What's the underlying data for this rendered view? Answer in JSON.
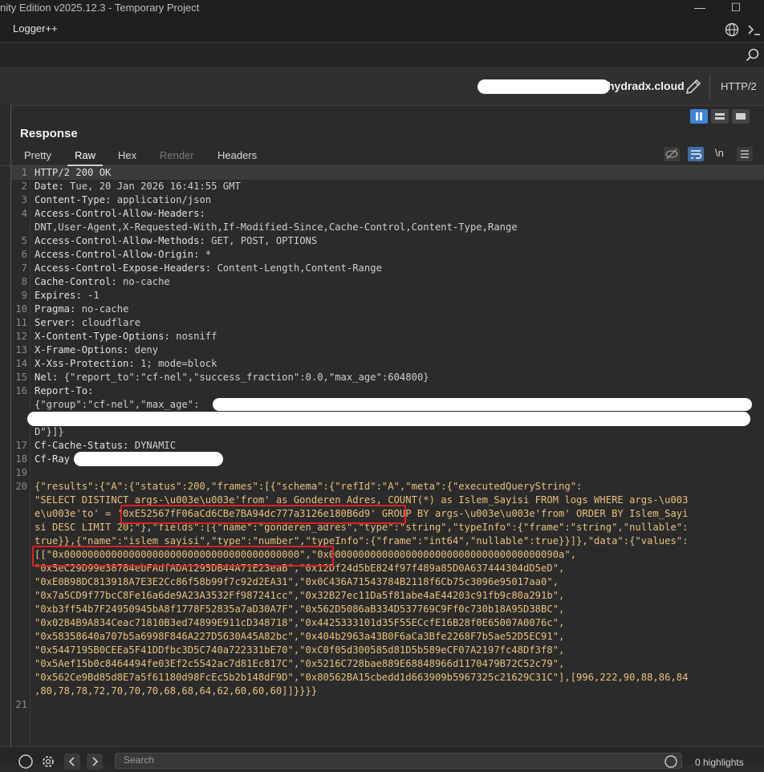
{
  "window": {
    "title": "nity Edition v2025.12.3 - Temporary Project",
    "minimize": "—",
    "maximize": "☐"
  },
  "menu": {
    "tab": "Logger++"
  },
  "target": {
    "host": "hydradx.cloud",
    "protocol": "HTTP/2"
  },
  "response": {
    "title": "Response",
    "tabs": [
      "Pretty",
      "Raw",
      "Hex",
      "Render",
      "Headers"
    ],
    "active_tab": "Raw",
    "newline_toggle": "\\n",
    "lines": [
      {
        "n": "1",
        "k": "HTTP/2 200 OK",
        "v": ""
      },
      {
        "n": "2",
        "k": "Date:",
        "v": " Tue, 20 Jan 2026 16:41:55 GMT"
      },
      {
        "n": "3",
        "k": "Content-Type:",
        "v": " application/json"
      },
      {
        "n": "4",
        "k": "Access-Control-Allow-Headers:",
        "v": ""
      },
      {
        "n": "",
        "k": "",
        "v": "DNT,User-Agent,X-Requested-With,If-Modified-Since,Cache-Control,Content-Type,Range"
      },
      {
        "n": "5",
        "k": "Access-Control-Allow-Methods:",
        "v": " GET, POST, OPTIONS"
      },
      {
        "n": "6",
        "k": "Access-Control-Allow-Origin:",
        "v": " *"
      },
      {
        "n": "7",
        "k": "Access-Control-Expose-Headers:",
        "v": " Content-Length,Content-Range"
      },
      {
        "n": "8",
        "k": "Cache-Control:",
        "v": " no-cache"
      },
      {
        "n": "9",
        "k": "Expires:",
        "v": " -1"
      },
      {
        "n": "10",
        "k": "Pragma:",
        "v": " no-cache"
      },
      {
        "n": "11",
        "k": "Server:",
        "v": " cloudflare"
      },
      {
        "n": "12",
        "k": "X-Content-Type-Options:",
        "v": " nosniff"
      },
      {
        "n": "13",
        "k": "X-Frame-Options:",
        "v": " deny"
      },
      {
        "n": "14",
        "k": "X-Xss-Protection:",
        "v": " 1; mode=block"
      },
      {
        "n": "15",
        "k": "Nel:",
        "v": " {\"report_to\":\"cf-nel\",\"success_fraction\":0.0,\"max_age\":604800}"
      },
      {
        "n": "16",
        "k": "Report-To:",
        "v": ""
      },
      {
        "n": "",
        "k": "",
        "v": "{\"group\":\"cf-nel\",\"max_age\":"
      },
      {
        "n": "",
        "k": "",
        "v": ""
      },
      {
        "n": "",
        "k": "",
        "v": "D\"}]}"
      },
      {
        "n": "17",
        "k": "Cf-Cache-Status:",
        "v": " DYNAMIC"
      },
      {
        "n": "18",
        "k": "Cf-Ray",
        "v": ""
      },
      {
        "n": "19",
        "k": "",
        "v": ""
      },
      {
        "n": "20",
        "k": "",
        "v": "{\"results\":{\"A\":{\"status\":200,\"frames\":[{\"schema\":{\"refId\":\"A\",\"meta\":{\"executedQueryString\":"
      },
      {
        "n": "",
        "k": "",
        "v": "\"SELECT DISTINCT args-\\u003e\\u003e'from' as Gonderen_Adres, COUNT(*) as Islem_Sayisi FROM logs WHERE args-\\u003"
      },
      {
        "n": "",
        "k": "",
        "v": "e\\u003e'to' = '0xE52567fF06aCd6CBe7BA94dc777a3126e180B6d9' GROUP BY args-\\u003e\\u003e'from' ORDER BY Islem_Sayi"
      },
      {
        "n": "",
        "k": "",
        "v": "si DESC LIMIT 20;\"},\"fields\":[{\"name\":\"gonderen_adres\",\"type\":\"string\",\"typeInfo\":{\"frame\":\"string\",\"nullable\":"
      },
      {
        "n": "",
        "k": "",
        "v": "true}},{\"name\":\"islem_sayisi\",\"type\":\"number\",\"typeInfo\":{\"frame\":\"int64\",\"nullable\":true}}]},\"data\":{\"values\":"
      },
      {
        "n": "",
        "k": "",
        "v": "[[\"0x0000000000000000000000000000000000000000\",\"0x000000000000000000000000000000000000090a\","
      },
      {
        "n": "",
        "k": "",
        "v": "\"0x5eC29D99e38784ebFAdfADA1295DB44A71E23eaB\",\"0x12Df24d5bE824f97f489a85D0A637444304dD5eD\","
      },
      {
        "n": "",
        "k": "",
        "v": "\"0xE0B98DC813918A7E3E2Cc86f58b99f7c92d2EA31\",\"0x0C436A71543784B2118f6Cb75c3096e95017aa0\","
      },
      {
        "n": "",
        "k": "",
        "v": "\"0x7a5CD9f77bcC8Fe16a6de9A23A3532Ff987241cc\",\"0x32B27ec11Da5f81abe4aE44203c91fb9c80a291b\","
      },
      {
        "n": "",
        "k": "",
        "v": "\"0xb3ff54b7F24950945bA8f1778F52835a7aD30A7F\",\"0x562D5086aB334D537769C9Ff0c730b18A95D38BC\","
      },
      {
        "n": "",
        "k": "",
        "v": "\"0x0284B9A834Ceac71810B3ed74899E911cD348718\",\"0x4425333101d35F55ECcfE16B28f0E65007A0076c\","
      },
      {
        "n": "",
        "k": "",
        "v": "\"0x58358640a707b5a6998F846A227D5630A45A82bc\",\"0x404b2963a43B0F6aCa3Bfe2268F7b5ae52D5EC91\","
      },
      {
        "n": "",
        "k": "",
        "v": "\"0x5447195B0CEEa5F41DDfbc3D5C740a722331bE70\",\"0xC0f05d300585d81D5b589eCF07A2197fc48Df3f8\","
      },
      {
        "n": "",
        "k": "",
        "v": "\"0x5Aef15b0c8464494fe03Ef2c5542ac7d81Ec817C\",\"0x5216C728bae889E68848966d1170479B72C52c79\","
      },
      {
        "n": "",
        "k": "",
        "v": "\"0x562Ce9Bd85d8E7a5f61180d98FcEc5b2b148dF9D\",\"0x80562BA15cbedd1d663909b5967325c21629C31C\"],[996,222,90,88,86,84"
      },
      {
        "n": "",
        "k": "",
        "v": ",80,78,78,72,70,70,70,68,68,64,62,60,60,60]]}}}}"
      },
      {
        "n": "21",
        "k": "",
        "v": ""
      }
    ]
  },
  "bottom": {
    "search_placeholder": "Search",
    "highlights": "0 highlights"
  }
}
